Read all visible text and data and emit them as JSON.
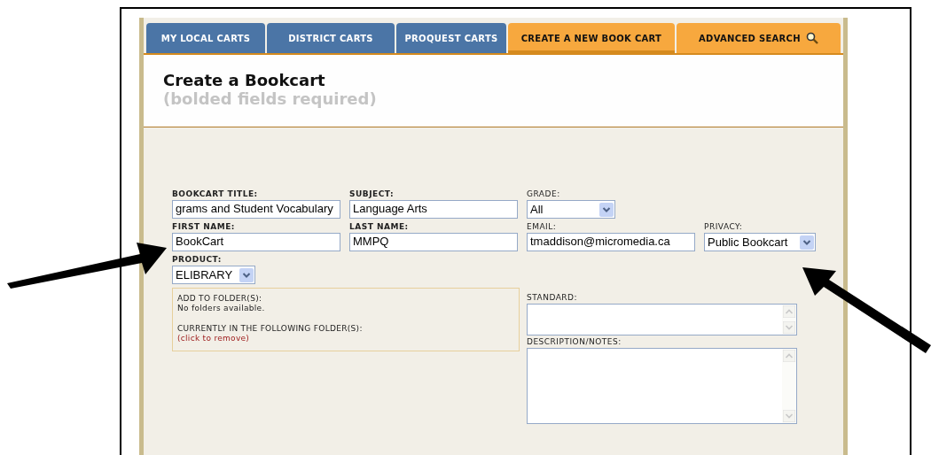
{
  "tabs": [
    {
      "label": "MY LOCAL CARTS",
      "color": "#4b75a6",
      "selected": false,
      "search_icon": false
    },
    {
      "label": "DISTRICT CARTS",
      "color": "#4b75a6",
      "selected": false,
      "search_icon": false
    },
    {
      "label": "PROQUEST CARTS",
      "color": "#4b75a6",
      "selected": false,
      "search_icon": false
    },
    {
      "label": "CREATE A NEW BOOK CART",
      "color": "#f7a83e",
      "selected": true,
      "search_icon": false
    },
    {
      "label": "ADVANCED SEARCH",
      "color": "#f7a83e",
      "selected": false,
      "search_icon": true
    }
  ],
  "heading": {
    "title": "Create a Bookcart",
    "subtitle": "(bolded fields required)"
  },
  "field_rows": [
    [
      {
        "label": "BOOKCART TITLE:",
        "required": true,
        "kind": "text",
        "value": "grams and Student Vocabulary"
      },
      {
        "label": "SUBJECT:",
        "required": true,
        "kind": "text",
        "value": "Language Arts"
      },
      {
        "label": "GRADE:",
        "required": false,
        "kind": "select",
        "value": "All"
      }
    ],
    [
      {
        "label": "FIRST NAME:",
        "required": true,
        "kind": "text",
        "value": "BookCart"
      },
      {
        "label": "LAST NAME:",
        "required": true,
        "kind": "text",
        "value": "MMPQ"
      },
      {
        "label": "EMAIL:",
        "required": false,
        "kind": "text",
        "value": "tmaddison@micromedia.ca"
      },
      {
        "label": "PRIVACY:",
        "required": false,
        "kind": "select",
        "value": "Public Bookcart"
      }
    ],
    [
      {
        "label": "PRODUCT:",
        "required": true,
        "kind": "select",
        "value": "ELIBRARY"
      }
    ]
  ],
  "folders": {
    "add_label": "ADD TO FOLDER(S):",
    "add_note": "No folders available.",
    "current_label": "CURRENTLY IN THE FOLLOWING FOLDER(S):",
    "remove_link": "(click to remove)"
  },
  "text_areas": [
    {
      "label": "STANDARD:"
    },
    {
      "label": "DESCRIPTION/NOTES:"
    }
  ]
}
